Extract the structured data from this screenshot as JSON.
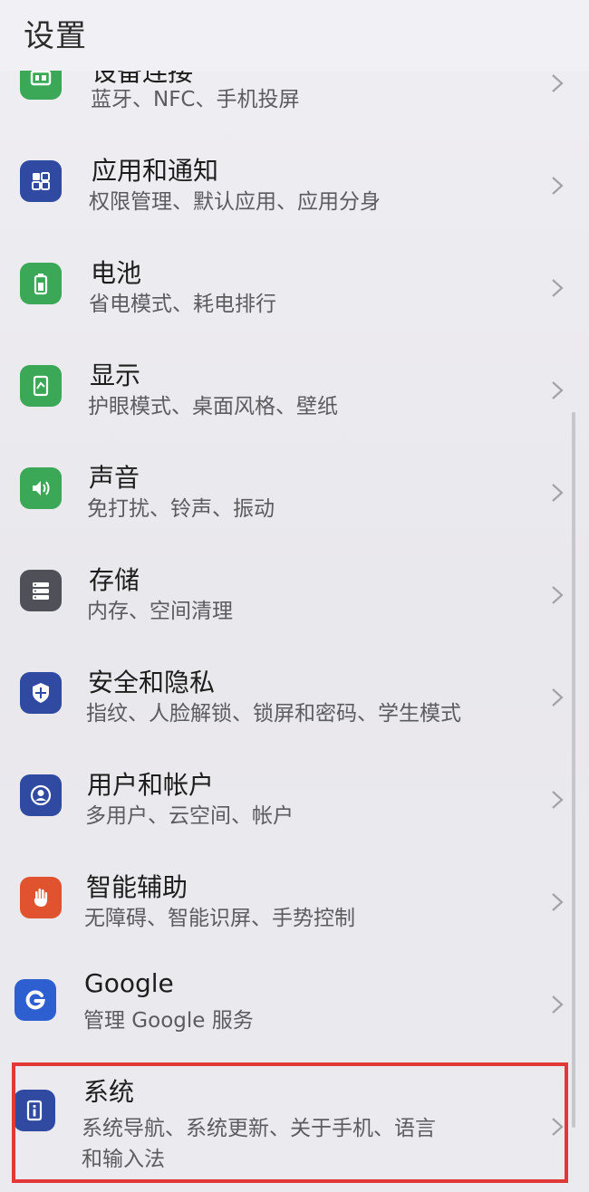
{
  "header": {
    "title": "设置"
  },
  "items": [
    {
      "title": "设备连接",
      "subtitle": "蓝牙、NFC、手机投屏",
      "icon": "device-connect-icon",
      "color": "#3aa856"
    },
    {
      "title": "应用和通知",
      "subtitle": "权限管理、默认应用、应用分身",
      "icon": "apps-grid-icon",
      "color": "#2f4aa0"
    },
    {
      "title": "电池",
      "subtitle": "省电模式、耗电排行",
      "icon": "battery-icon",
      "color": "#3aa856"
    },
    {
      "title": "显示",
      "subtitle": "护眼模式、桌面风格、壁纸",
      "icon": "display-icon",
      "color": "#3aa856"
    },
    {
      "title": "声音",
      "subtitle": "免打扰、铃声、振动",
      "icon": "speaker-icon",
      "color": "#3aa856"
    },
    {
      "title": "存储",
      "subtitle": "内存、空间清理",
      "icon": "storage-icon",
      "color": "#505058"
    },
    {
      "title": "安全和隐私",
      "subtitle": "指纹、人脸解锁、锁屏和密码、学生模式",
      "icon": "shield-icon",
      "color": "#2f4aa0"
    },
    {
      "title": "用户和帐户",
      "subtitle": "多用户、云空间、帐户",
      "icon": "user-icon",
      "color": "#2f4aa0"
    },
    {
      "title": "智能辅助",
      "subtitle": "无障碍、智能识屏、手势控制",
      "icon": "hand-icon",
      "color": "#e0532e"
    },
    {
      "title": "Google",
      "subtitle": "管理 Google 服务",
      "icon": "google-icon",
      "color": "#2d5fd0"
    },
    {
      "title": "系统",
      "subtitle": "系统导航、系统更新、关于手机、语言",
      "subtitle2": "和输入法",
      "icon": "system-icon",
      "color": "#2f4aa0"
    }
  ]
}
